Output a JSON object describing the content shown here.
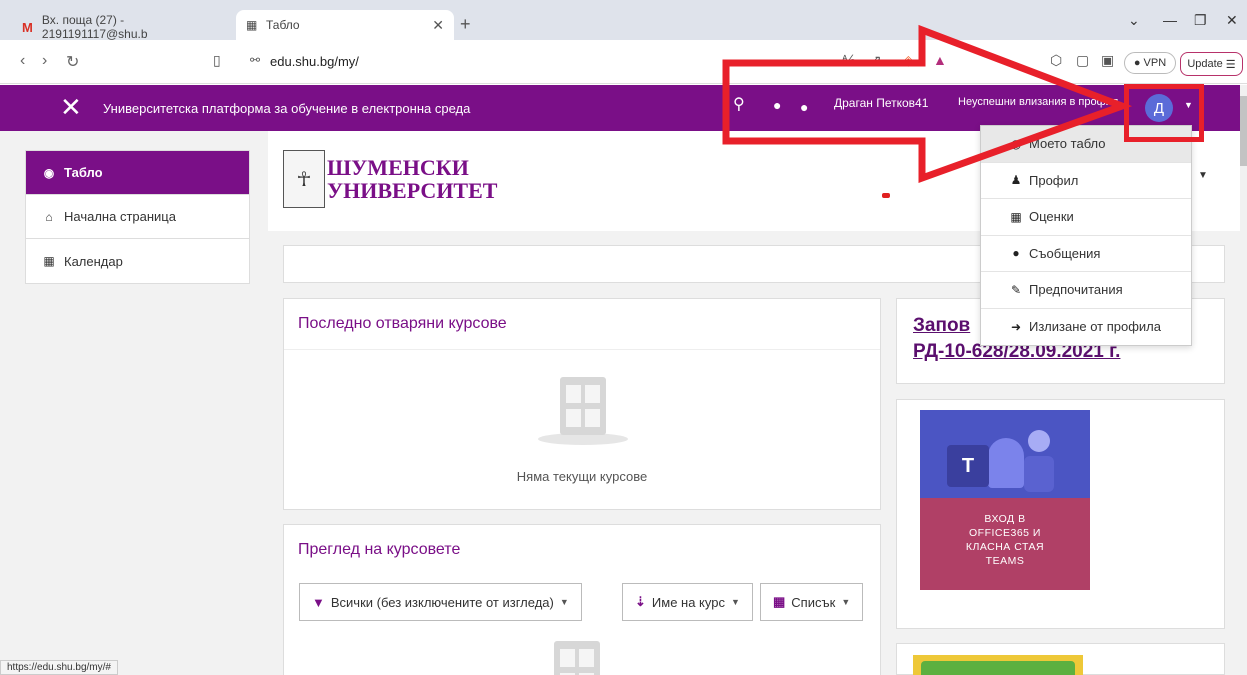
{
  "browser": {
    "tabs": [
      {
        "title": "Вх. поща (27) - 2191191117@shu.b",
        "favicon": "gmail-icon"
      },
      {
        "title": "Табло",
        "favicon": "university-icon",
        "active": true
      }
    ],
    "url": "edu.shu.bg/my/",
    "vpn_label": "VPN",
    "update_label": "Update",
    "status_url": "https://edu.shu.bg/my/#"
  },
  "navbar": {
    "site_name": "Университетска платформа за обучение в електронна среда",
    "user_name": "Драган Петков41",
    "login_fails": "Неуспешни влизания в профил",
    "avatar_letter": "Д"
  },
  "drawer": {
    "items": [
      {
        "label": "Табло",
        "icon": "dashboard-icon",
        "active": true
      },
      {
        "label": "Начална страница",
        "icon": "home-icon"
      },
      {
        "label": "Календар",
        "icon": "calendar-icon"
      }
    ]
  },
  "logo": {
    "line1": "ШУМЕНСКИ",
    "line2": "УНИВЕРСИТЕТ"
  },
  "recent": {
    "title": "Последно отваряни курсове",
    "empty": "Няма текущи курсове"
  },
  "overview": {
    "title": "Преглед на курсовете",
    "filter": "Всички (без изключените от изгледа)",
    "sort": "Име на курс",
    "view": "Списък"
  },
  "news": {
    "line1": "Запов",
    "line2": "РД-10-628/28.09.2021 г."
  },
  "teams": {
    "line1": "ВХОД В",
    "line2": "OFFICE365 И",
    "line3": "КЛАСНА СТАЯ",
    "line4": "TEAMS"
  },
  "user_menu": {
    "items": [
      {
        "label": "Моето табло",
        "icon": "dashboard-icon",
        "active": true
      },
      {
        "label": "Профил",
        "icon": "user-icon"
      },
      {
        "label": "Оценки",
        "icon": "table-icon"
      },
      {
        "label": "Съобщения",
        "icon": "chat-icon"
      },
      {
        "label": "Предпочитания",
        "icon": "wrench-icon"
      },
      {
        "label": "Излизане от профила",
        "icon": "logout-icon"
      }
    ]
  },
  "annotation": {
    "color": "#e8202a"
  },
  "colors": {
    "brand": "#7a0f87",
    "avatar": "#5b6bd8",
    "teams_pink": "#b04066",
    "teams_blue": "#4b55c3"
  }
}
